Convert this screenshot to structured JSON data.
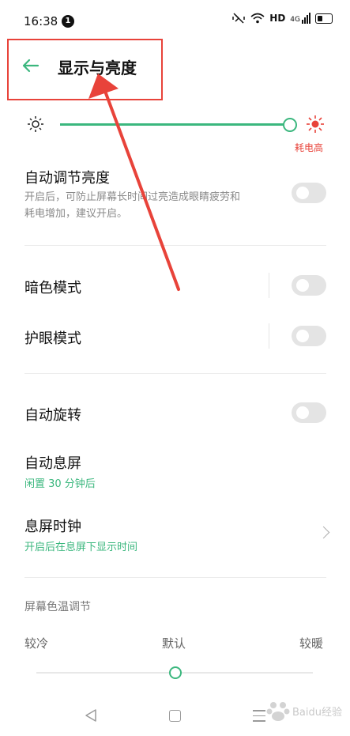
{
  "status_bar": {
    "time": "16:38",
    "notification_count": "1",
    "hd_label": "HD",
    "network_label": "4G"
  },
  "header": {
    "title": "显示与亮度"
  },
  "brightness": {
    "level": 0.99,
    "high_power_label": "耗电高"
  },
  "auto_brightness": {
    "title": "自动调节亮度",
    "description_line1": "开启后，可防止屏幕长时间过亮造成眼睛疲劳和",
    "description_line2": "耗电增加，建议开启。",
    "enabled": false
  },
  "dark_mode": {
    "title": "暗色模式",
    "enabled": false
  },
  "eye_care": {
    "title": "护眼模式",
    "enabled": false
  },
  "auto_rotate": {
    "title": "自动旋转",
    "enabled": false
  },
  "auto_sleep": {
    "title": "自动息屏",
    "subtitle": "闲置 30 分钟后"
  },
  "screen_off_clock": {
    "title": "息屏时钟",
    "subtitle": "开启后在息屏下显示时间"
  },
  "color_temperature": {
    "section_label": "屏幕色温调节",
    "cool_label": "较冷",
    "default_label": "默认",
    "warm_label": "较暖",
    "level": 0.5
  },
  "colors": {
    "accent": "#3bb77e",
    "warning": "#e8433a"
  },
  "watermark": {
    "text": "Baidu经验"
  }
}
